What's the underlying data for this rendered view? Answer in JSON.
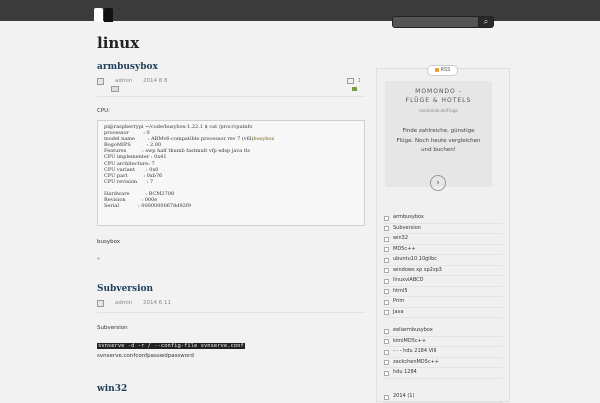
{
  "site": {
    "title": "linux"
  },
  "search": {
    "button_label": "⌕"
  },
  "posts": [
    {
      "title": "armbusybox",
      "author": "admin",
      "date": "2014  8  8",
      "comments": "1",
      "intro": "CPU:",
      "code": [
        {
          "t": "pi@raspberrypi ~/code/busybox-1.22.1 $ cat /proc/cpuinfo"
        },
        {
          "t": "processor         : 0"
        },
        {
          "t": "model name        : ARMv6-compatible processor rev 7 (v6l)",
          "h": "busybox"
        },
        {
          "t": "BogoMIPS          : 2.00"
        },
        {
          "t": "Features          : swp half thumb fastmult vfp edsp java tls"
        },
        {
          "t": "CPU implementer : 0x41"
        },
        {
          "t": "CPU architecture: 7"
        },
        {
          "t": "CPU variant       : 0x0"
        },
        {
          "t": "CPU part          : 0xb76"
        },
        {
          "t": "CPU revision      : 7"
        },
        {
          "t": ""
        },
        {
          "t": "Hardware          : BCM2708"
        },
        {
          "t": "Revision          : 000e"
        },
        {
          "t": "Serial            : 00000000678d92f9"
        }
      ],
      "outro": "busybox",
      "footer": "»"
    },
    {
      "title": "Subversion",
      "author": "admin",
      "date": "2014  6  11",
      "intro": "Subversion",
      "cmd": "svnserve -d -r / --config-file svnserve.conf",
      "line2": "svnserve.confconfpasswdpassword"
    },
    {
      "title": "win32"
    }
  ],
  "sidebar": {
    "rss_label": "RSS",
    "ad": {
      "title_line1": "MOMONDO -",
      "title_line2": "FLÜGE & HOTELS",
      "subtitle": "momondo.de/Flüge",
      "body_line1": "Finde zahlreiche, günstige",
      "body_line2": "Flüge. Noch heute vergleichen",
      "body_line3": "und buchen!",
      "button": "›"
    },
    "recent_posts": [
      "armbusybox",
      "Subversion",
      "win32",
      "MD5c++",
      "ubuntu10.10glibc",
      "windows xp sp2sp3",
      "linuxviABCD",
      "html5",
      "Prim",
      "Java"
    ],
    "recent_comments": [
      "eeliarmbusybox",
      "kimiMD5c++",
      "- - -       hdu 2184 VIII",
      "zackchenMD5c++",
      "hdu 1284"
    ],
    "archives": [
      "2014 (1)"
    ]
  },
  "colors": {
    "topbar": "#3b3b3b",
    "link": "#1e3e5a",
    "rss": "#f29b2b"
  }
}
